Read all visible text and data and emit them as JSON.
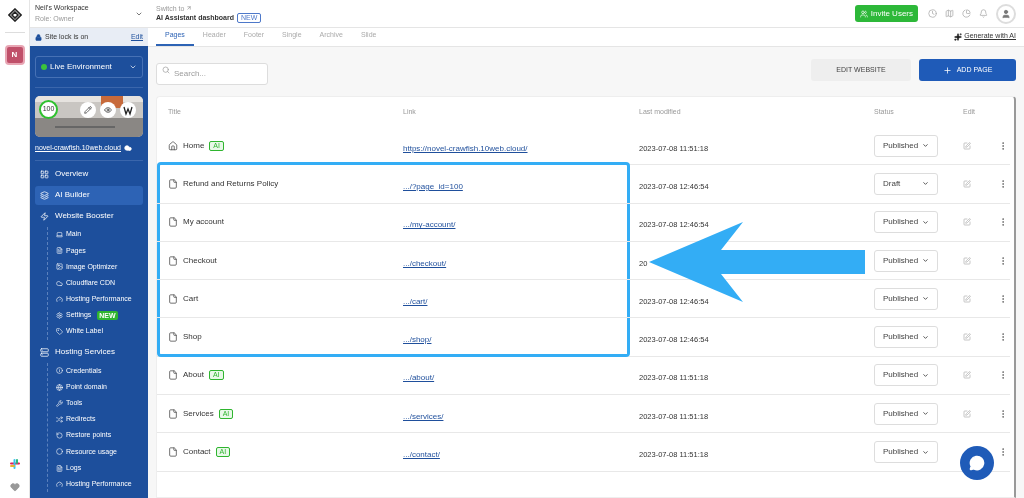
{
  "rail": {
    "avatar": "N"
  },
  "workspace": {
    "name": "Neil's Workspace",
    "role": "Role: Owner"
  },
  "site_lock": {
    "label": "Site lock is on",
    "action": "Edit"
  },
  "environment": {
    "label": "Live Environment",
    "live": true
  },
  "preview": {
    "score": "100"
  },
  "domain": "novel-crawfish.10web.cloud",
  "nav": [
    {
      "label": "Overview",
      "selected": false
    },
    {
      "label": "AI Builder",
      "selected": true
    },
    {
      "label": "Website Booster",
      "selected": false,
      "children": [
        {
          "label": "Main"
        },
        {
          "label": "Pages"
        },
        {
          "label": "Image Optimizer"
        },
        {
          "label": "Cloudflare CDN"
        },
        {
          "label": "Hosting Performance"
        },
        {
          "label": "Settings",
          "badge": "NEW"
        },
        {
          "label": "White Label"
        }
      ]
    },
    {
      "label": "Hosting Services",
      "selected": false,
      "children": [
        {
          "label": "Credentials"
        },
        {
          "label": "Point domain"
        },
        {
          "label": "Tools"
        },
        {
          "label": "Redirects"
        },
        {
          "label": "Restore points"
        },
        {
          "label": "Resource usage"
        },
        {
          "label": "Logs"
        },
        {
          "label": "Hosting Performance"
        }
      ]
    }
  ],
  "topbar": {
    "switch_label": "Switch to",
    "dashboard": "AI Assistant dashboard",
    "badge": "NEW",
    "invite": "Invite Users"
  },
  "tabs": [
    {
      "label": "Pages",
      "selected": true
    },
    {
      "label": "Header",
      "selected": false
    },
    {
      "label": "Footer",
      "selected": false
    },
    {
      "label": "Single",
      "selected": false
    },
    {
      "label": "Archive",
      "selected": false
    },
    {
      "label": "Slide",
      "selected": false
    }
  ],
  "generate": "Generate with AI",
  "search": {
    "placeholder": "Search..."
  },
  "buttons": {
    "edit": "EDIT WEBSITE",
    "add": "ADD PAGE"
  },
  "table": {
    "columns": [
      "Title",
      "Link",
      "Last modified",
      "Status",
      "Edit"
    ],
    "arrow": true,
    "rows": [
      {
        "kind": "home",
        "title": "Home",
        "badge": "AI",
        "link": "https://novel-crawfish.10web.cloud/",
        "modified": "2023-07-08 11:51:18",
        "status": "Published",
        "highlighted": false
      },
      {
        "kind": "page",
        "title": "Refund and Returns Policy",
        "link": ".../?page_id=100",
        "modified": "2023-07-08 12:46:54",
        "status": "Draft",
        "highlighted": true
      },
      {
        "kind": "page",
        "title": "My account",
        "link": ".../my-account/",
        "modified": "2023-07-08 12:46:54",
        "status": "Published",
        "highlighted": true
      },
      {
        "kind": "page",
        "title": "Checkout",
        "link": ".../checkout/",
        "modified": "20",
        "status": "Published",
        "highlighted": true
      },
      {
        "kind": "page",
        "title": "Cart",
        "link": ".../cart/",
        "modified": "2023-07-08 12:46:54",
        "status": "Published",
        "highlighted": true
      },
      {
        "kind": "page",
        "title": "Shop",
        "link": ".../shop/",
        "modified": "2023-07-08 12:46:54",
        "status": "Published",
        "highlighted": true
      },
      {
        "kind": "page",
        "title": "About",
        "badge": "AI",
        "link": ".../about/",
        "modified": "2023-07-08 11:51:18",
        "status": "Published",
        "highlighted": false
      },
      {
        "kind": "page",
        "title": "Services",
        "badge": "AI",
        "link": ".../services/",
        "modified": "2023-07-08 11:51:18",
        "status": "Published",
        "highlighted": false
      },
      {
        "kind": "page",
        "title": "Contact",
        "badge": "AI",
        "link": ".../contact/",
        "modified": "2023-07-08 11:51:18",
        "status": "Published",
        "highlighted": false
      }
    ]
  }
}
